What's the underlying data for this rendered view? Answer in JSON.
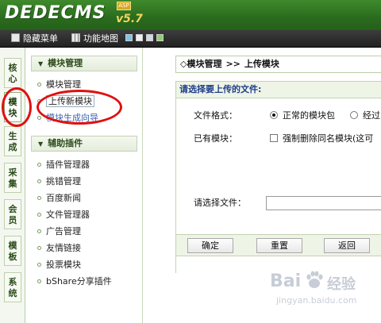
{
  "header": {
    "logo": "DEDECMS",
    "version": "v5.7",
    "badge": "ASP"
  },
  "toolbar": {
    "hide_menu": "隐藏菜单",
    "function_map": "功能地图",
    "swatch_colors": [
      "#7ec3e8",
      "#f0f0f0",
      "#cfd8e3",
      "#8fcf6a"
    ]
  },
  "vtabs": [
    {
      "label": "核心"
    },
    {
      "label": "模块"
    },
    {
      "label": "生成"
    },
    {
      "label": "采集"
    },
    {
      "label": "会员"
    },
    {
      "label": "模板"
    },
    {
      "label": "系统"
    }
  ],
  "menu": {
    "section1": {
      "title": "模块管理",
      "items": [
        {
          "label": "模块管理"
        },
        {
          "label": "上传新模块"
        },
        {
          "label": "模块生成向导"
        }
      ]
    },
    "section2": {
      "title": "辅助插件",
      "items": [
        {
          "label": "插件管理器"
        },
        {
          "label": "挑错管理"
        },
        {
          "label": "百度新闻"
        },
        {
          "label": "文件管理器"
        },
        {
          "label": "广告管理"
        },
        {
          "label": "友情链接"
        },
        {
          "label": "投票模块"
        },
        {
          "label": "bShare分享插件"
        }
      ]
    }
  },
  "main": {
    "breadcrumb": {
      "root": "◇模块管理",
      "sep": ">>",
      "current": "上传模块"
    },
    "form_title": "请选择要上传的文件:",
    "file_format_label": "文件格式：",
    "format_option_normal": "正常的模块包",
    "format_option_other": "经过",
    "existing_label": "已有模块：",
    "force_delete_label": "强制删除同名模块(这可",
    "choose_file_label": "请选择文件：",
    "buttons": {
      "ok": "确定",
      "reset": "重置",
      "back": "返回"
    }
  },
  "watermark": {
    "brand": "Bai",
    "brand_cn": "经验",
    "url": "jingyan.baidu.com"
  },
  "colors": {
    "header_green": "#2a6b1e",
    "annotation_red": "#e01010",
    "form_title_blue": "#1e3d8a"
  }
}
